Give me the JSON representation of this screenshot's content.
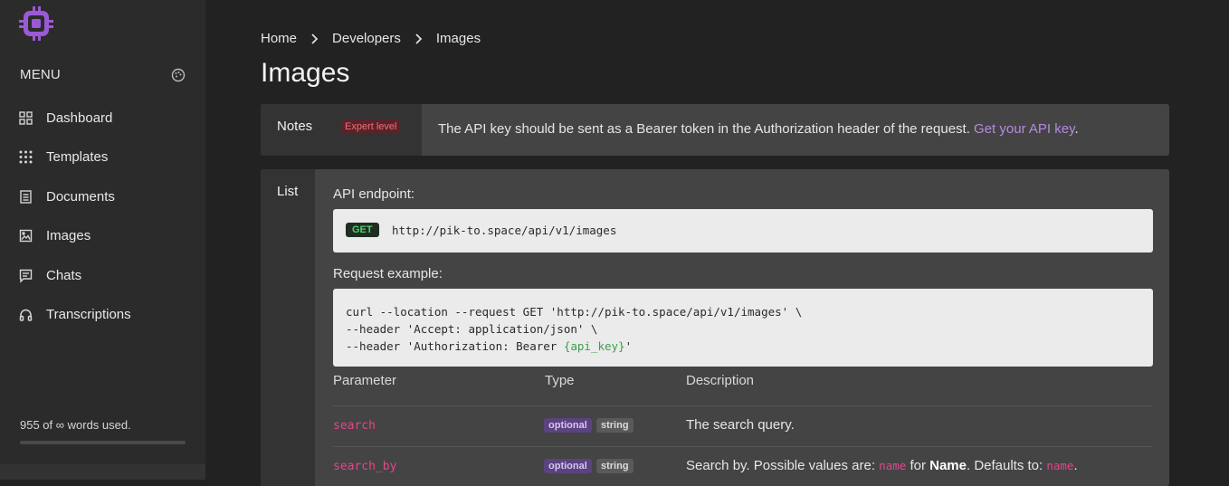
{
  "sidebar": {
    "menu_title": "MENU",
    "items": [
      {
        "label": "Dashboard",
        "icon": "grid-icon"
      },
      {
        "label": "Templates",
        "icon": "dots-grid-icon"
      },
      {
        "label": "Documents",
        "icon": "document-icon"
      },
      {
        "label": "Images",
        "icon": "image-icon"
      },
      {
        "label": "Chats",
        "icon": "chat-icon"
      },
      {
        "label": "Transcriptions",
        "icon": "headphones-icon"
      }
    ],
    "usage_text": "955 of ∞ words used.",
    "usage_fraction": 0
  },
  "breadcrumb": {
    "items": [
      "Home",
      "Developers",
      "Images"
    ]
  },
  "page": {
    "title": "Images"
  },
  "notes": {
    "label": "Notes",
    "badge": "Expert level",
    "text": "The API key should be sent as a Bearer token in the Authorization header of the request. ",
    "link": "Get your API key",
    "suffix": "."
  },
  "list": {
    "label": "List",
    "endpoint_label": "API endpoint:",
    "method": "GET",
    "endpoint_url": "http://pik-to.space/api/v1/images",
    "request_label": "Request example:",
    "request_lines": [
      "curl --location --request GET 'http://pik-to.space/api/v1/images' \\",
      "--header 'Accept: application/json' \\",
      "--header 'Authorization: Bearer "
    ],
    "request_var": "{api_key}",
    "request_tail": "'"
  },
  "table": {
    "headers": [
      "Parameter",
      "Type",
      "Description"
    ],
    "rows": [
      {
        "param": "search",
        "tags": [
          "optional",
          "string"
        ],
        "description": "The search query."
      },
      {
        "param": "search_by",
        "tags": [
          "optional",
          "string"
        ],
        "desc_prefix": "Search by. Possible values are: ",
        "desc_code1": "name",
        "desc_mid": " for ",
        "desc_bold": "Name",
        "desc_mid2": ". Defaults to: ",
        "desc_code2": "name",
        "desc_suffix": "."
      }
    ]
  },
  "colors": {
    "accent": "#9b59d6",
    "link": "#b48be0",
    "param": "#e2478a",
    "get_green": "#4fcf6b"
  }
}
